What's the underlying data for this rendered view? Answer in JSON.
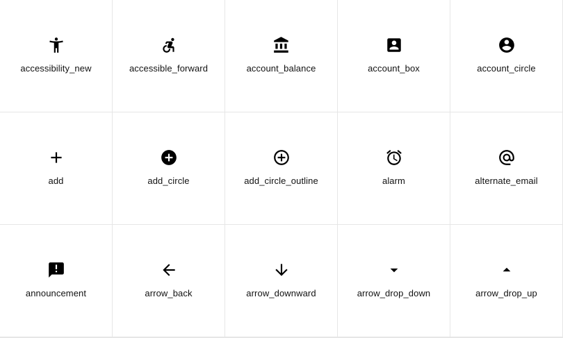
{
  "icons": [
    {
      "label": "accessibility_new",
      "icon": "accessibility-new-icon"
    },
    {
      "label": "accessible_forward",
      "icon": "accessible-forward-icon"
    },
    {
      "label": "account_balance",
      "icon": "account-balance-icon"
    },
    {
      "label": "account_box",
      "icon": "account-box-icon"
    },
    {
      "label": "account_circle",
      "icon": "account-circle-icon"
    },
    {
      "label": "add",
      "icon": "add-icon"
    },
    {
      "label": "add_circle",
      "icon": "add-circle-icon"
    },
    {
      "label": "add_circle_outline",
      "icon": "add-circle-outline-icon"
    },
    {
      "label": "alarm",
      "icon": "alarm-icon"
    },
    {
      "label": "alternate_email",
      "icon": "alternate-email-icon"
    },
    {
      "label": "announcement",
      "icon": "announcement-icon"
    },
    {
      "label": "arrow_back",
      "icon": "arrow-back-icon"
    },
    {
      "label": "arrow_downward",
      "icon": "arrow-downward-icon"
    },
    {
      "label": "arrow_drop_down",
      "icon": "arrow-drop-down-icon"
    },
    {
      "label": "arrow_drop_up",
      "icon": "arrow-drop-up-icon"
    }
  ]
}
